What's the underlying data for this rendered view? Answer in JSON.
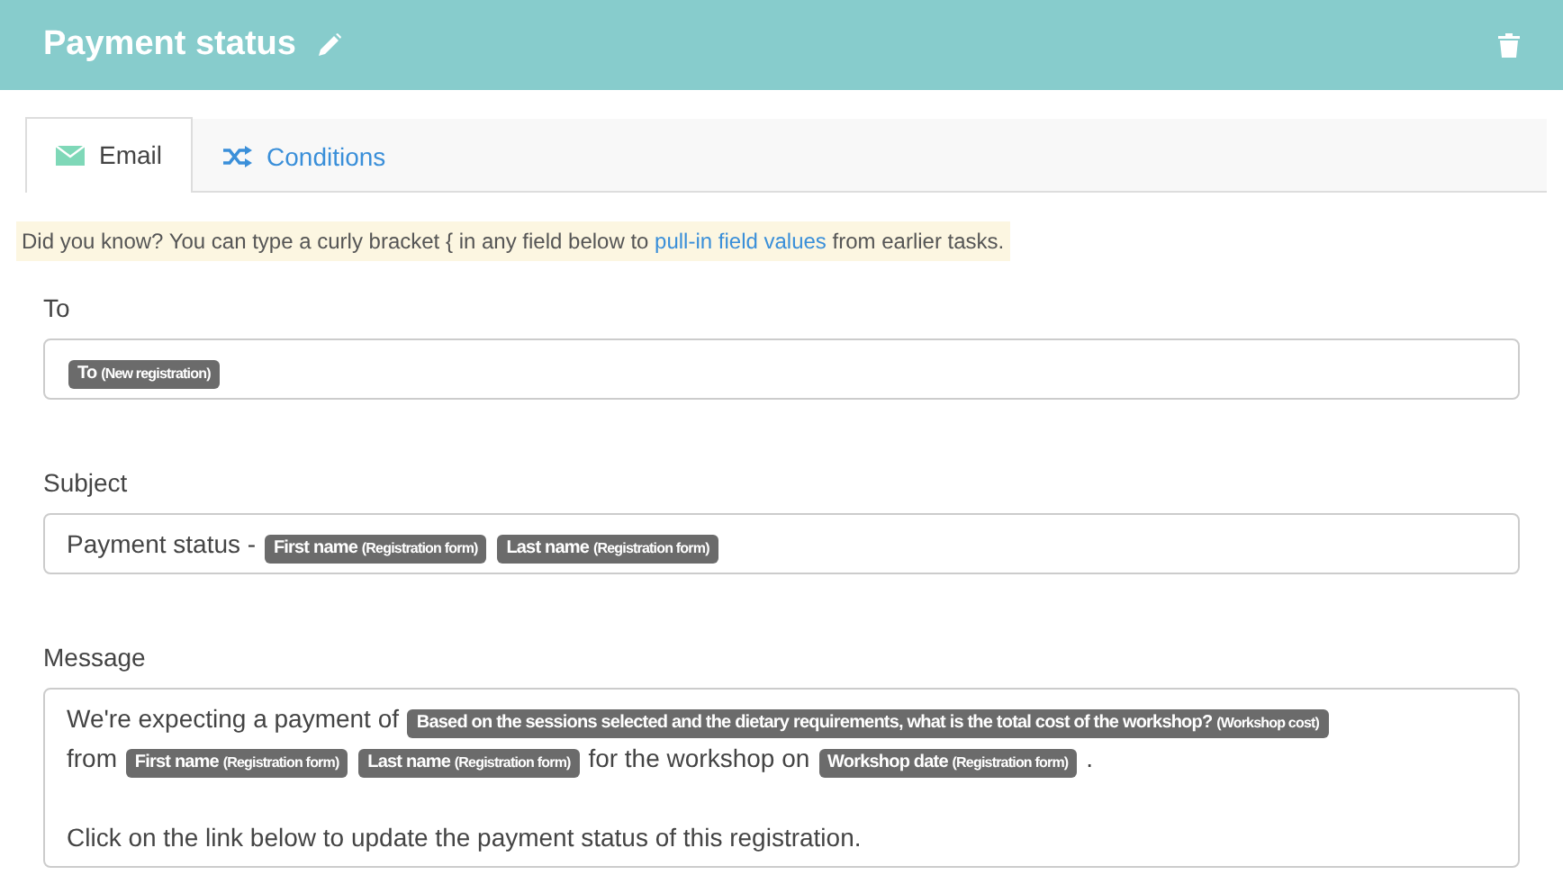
{
  "header": {
    "title": "Payment status"
  },
  "tabs": [
    {
      "label": "Email",
      "kind": "email",
      "selected": true
    },
    {
      "label": "Conditions",
      "kind": "shuffle",
      "selected": false
    }
  ],
  "tip": {
    "before": "Did you know? You can type a curly bracket { in any field below to ",
    "link": "pull-in field values",
    "after": " from earlier tasks."
  },
  "fields": [
    {
      "label": "To",
      "lines": [
        [
          {
            "kind": "token",
            "name": "To",
            "source": "(New registration)"
          }
        ]
      ]
    },
    {
      "label": "Subject",
      "lines": [
        [
          {
            "kind": "text",
            "text": "Payment status -"
          },
          {
            "kind": "token",
            "name": "First name",
            "source": "(Registration form)"
          },
          {
            "kind": "token",
            "name": "Last name",
            "source": "(Registration form)"
          }
        ]
      ]
    },
    {
      "label": "Message",
      "lines": [
        [
          {
            "kind": "text",
            "text": "We're expecting a payment of"
          },
          {
            "kind": "token",
            "name": "Based on the sessions selected and the dietary requirements, what is the total cost of the workshop?",
            "source": "(Workshop cost)"
          }
        ],
        [
          {
            "kind": "text",
            "text": "from"
          },
          {
            "kind": "token",
            "name": "First name",
            "source": "(Registration form)"
          },
          {
            "kind": "token",
            "name": "Last name",
            "source": "(Registration form)"
          },
          {
            "kind": "text",
            "text": "for the workshop on"
          },
          {
            "kind": "token",
            "name": "Workshop date",
            "source": "(Registration form)"
          },
          {
            "kind": "text",
            "text": "."
          }
        ],
        [
          {
            "kind": "gap"
          },
          {
            "kind": "text",
            "text": "Click on the link below to update the payment status of this registration."
          }
        ]
      ]
    }
  ]
}
